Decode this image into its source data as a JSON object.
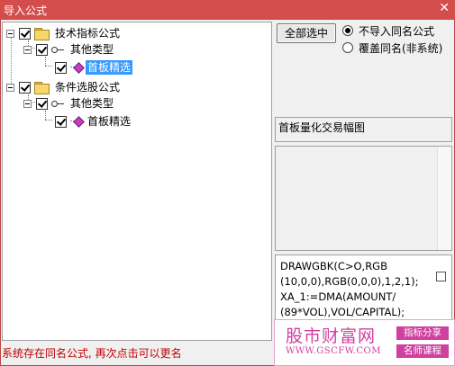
{
  "window": {
    "title": "导入公式"
  },
  "tree": {
    "nodes": [
      {
        "label": "技术指标公式",
        "checked": true
      },
      {
        "label": "其他类型",
        "checked": true
      },
      {
        "label": "首板精选",
        "checked": true,
        "selected": true
      },
      {
        "label": "条件选股公式",
        "checked": true
      },
      {
        "label": "其他类型",
        "checked": true
      },
      {
        "label": "首板精选",
        "checked": true,
        "selected": false
      }
    ]
  },
  "controls": {
    "select_all_label": "全部选中",
    "radio_no_import_label": "不导入同名公式",
    "radio_overwrite_label": "覆盖同名(非系统)"
  },
  "details": {
    "description": "首板量化交易幅图",
    "code": "DRAWGBK(C>O,RGB\n(10,0,0),RGB(0,0,0),1,2,1);\nXA_1:=DMA(AMOUNT/\n(89*VOL),VOL/CAPITAL);"
  },
  "watermark": {
    "brand": "股市财富网",
    "url": "WWW.GSCFW.COM",
    "tag1": "指标分享",
    "tag2": "名师课程"
  },
  "status": {
    "message": "系统存在同名公式, 再次点击可以更名"
  },
  "colors": {
    "titlebar": "#d44d4d",
    "selection": "#3399ff",
    "status_text": "#c00000",
    "watermark": "#d040a0"
  }
}
